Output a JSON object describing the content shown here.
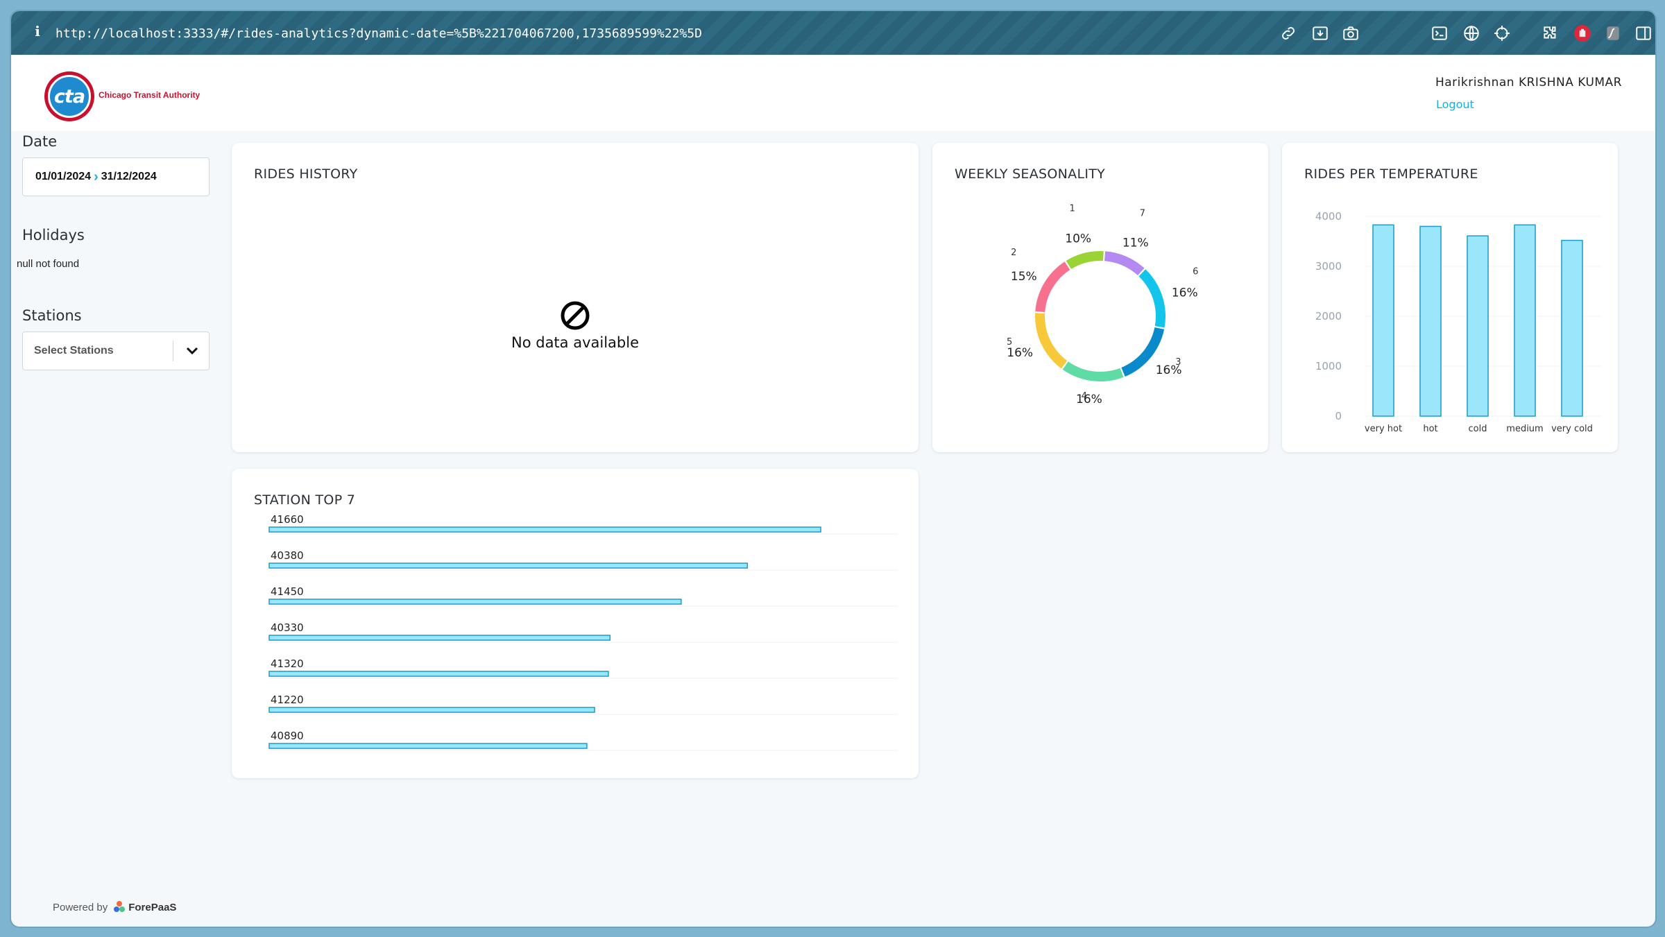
{
  "browser": {
    "info_label": "i",
    "url": "http://localhost:3333/#/rides-analytics?dynamic-date=%5B%221704067200,1735689599%22%5D"
  },
  "header": {
    "logo_abbr": "cta",
    "logo_name": "Chicago Transit Authority",
    "user_name": "Harikrishnan KRISHNA KUMAR",
    "logout": "Logout"
  },
  "sidebar": {
    "date_label": "Date",
    "date_start": "01/01/2024",
    "date_end": "31/12/2024",
    "holidays_label": "Holidays",
    "holidays_text": "null not found",
    "stations_label": "Stations",
    "stations_placeholder": "Select Stations"
  },
  "rides_history": {
    "title": "RIDES HISTORY",
    "no_data": "No data available"
  },
  "weekly": {
    "title": "WEEKLY SEASONALITY"
  },
  "temperature": {
    "title": "RIDES PER TEMPERATURE"
  },
  "top7": {
    "title": "STATION TOP 7"
  },
  "footer": {
    "powered_by": "Powered by",
    "brand": "ForePaaS"
  },
  "colors": {
    "accent": "#1bb0d8",
    "bar_fill": "#9be6fa",
    "bar_stroke": "#1c9bc9"
  },
  "chart_data": [
    {
      "type": "pie",
      "title": "WEEKLY SEASONALITY",
      "categories": [
        "1",
        "7",
        "6",
        "3",
        "4",
        "5",
        "2"
      ],
      "values": [
        10,
        11,
        16,
        16,
        16,
        16,
        15
      ],
      "labels": [
        "10%",
        "11%",
        "16%",
        "16%",
        "16%",
        "16%",
        "15%"
      ],
      "colors": [
        "#9ad334",
        "#b48af2",
        "#13c5ea",
        "#0b8acb",
        "#5fdca6",
        "#f6c83a",
        "#f7708d"
      ]
    },
    {
      "type": "bar",
      "title": "RIDES PER TEMPERATURE",
      "categories": [
        "very hot",
        "hot",
        "cold",
        "medium",
        "very cold"
      ],
      "values": [
        3830,
        3800,
        3610,
        3830,
        3520
      ],
      "yticks": [
        "0",
        "1000",
        "2000",
        "3000",
        "4000"
      ],
      "ylim": [
        0,
        4000
      ],
      "grid": true
    },
    {
      "type": "bar",
      "orientation": "horizontal",
      "title": "STATION TOP 7",
      "categories": [
        "41660",
        "40380",
        "41450",
        "40330",
        "41320",
        "41220",
        "40890"
      ],
      "values": [
        100,
        86.7,
        74.7,
        61.8,
        61.5,
        59.0,
        57.6
      ]
    }
  ]
}
